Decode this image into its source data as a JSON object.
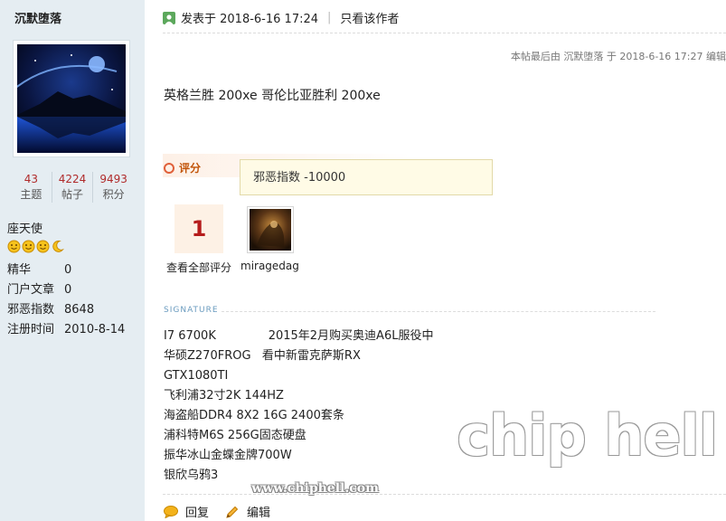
{
  "sidebar": {
    "username": "沉默堕落",
    "stats": [
      {
        "value": "43",
        "label": "主题"
      },
      {
        "value": "4224",
        "label": "帖子"
      },
      {
        "value": "9493",
        "label": "积分"
      }
    ],
    "rank": "座天使",
    "star_icons": [
      "smiley-icon",
      "smiley-icon",
      "smiley-icon",
      "moon-icon"
    ],
    "info": [
      {
        "key": "精华",
        "value": "0"
      },
      {
        "key": "门户文章",
        "value": "0"
      },
      {
        "key": "邪恶指数",
        "value": "8648"
      },
      {
        "key": "注册时间",
        "value": "2010-8-14"
      }
    ]
  },
  "post": {
    "posted_at": "发表于 2018-6-16 17:24",
    "only_author": "只看该作者",
    "last_edit": "本帖最后由 沉默堕落 于 2018-6-16 17:27 编辑",
    "content": "英格兰胜 200xe 哥伦比亚胜利 200xe"
  },
  "rating": {
    "title": "评分",
    "tooltip": "邪恶指数 -10000",
    "count": "1",
    "view_all": "查看全部评分",
    "rater_name": "miragedag"
  },
  "signature": {
    "label": "SIGNATURE",
    "lines": [
      "I7 6700K              2015年2月购买奥迪A6L服役中",
      "华硕Z270FROG   看中新雷克萨斯RX",
      "GTX1080TI",
      "飞利浦32寸2K 144HZ",
      "海盗船DDR4 8X2 16G 2400套条",
      "浦科特M6S 256G固态硬盘",
      "振华冰山金蝶金牌700W",
      "银欣乌鸦3"
    ]
  },
  "actions": {
    "reply": "回复",
    "edit": "编辑"
  },
  "watermark": {
    "logo": "chip hell",
    "url": "www.chiphell.com"
  },
  "colors": {
    "sidebar_bg": "#e5edf2",
    "stat_number": "#b02b2b",
    "rate_accent": "#c2550a",
    "count_number": "#b51c1c",
    "signature_label": "#6a9bbf"
  }
}
